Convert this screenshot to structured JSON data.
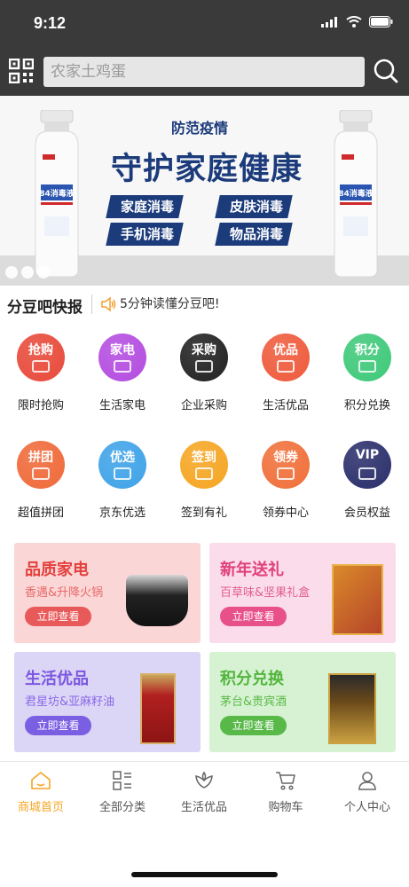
{
  "status": {
    "time": "9:12"
  },
  "search": {
    "placeholder": "农家土鸡蛋"
  },
  "banner": {
    "subtitle": "防范疫情",
    "title": "守护家庭健康",
    "tags": [
      "家庭消毒",
      "皮肤消毒",
      "手机消毒",
      "物品消毒"
    ],
    "bottle_label": "84消毒液"
  },
  "news": {
    "logo": "分豆吧快报",
    "text": "5分钟读懂分豆吧!"
  },
  "grid": [
    {
      "icon_text": "抢购",
      "label": "限时抢购",
      "color": "#e84a3a",
      "icon": "alarm-clock-icon"
    },
    {
      "icon_text": "家电",
      "label": "生活家电",
      "color": "#b44de0",
      "icon": "washing-machine-icon"
    },
    {
      "icon_text": "采购",
      "label": "企业采购",
      "color": "#222222",
      "icon": "purchase-icon"
    },
    {
      "icon_text": "优品",
      "label": "生活优品",
      "color": "#ef5b3c",
      "icon": "hand-icon"
    },
    {
      "icon_text": "积分",
      "label": "积分兑换",
      "color": "#3fc97a",
      "icon": "shop-icon"
    },
    {
      "icon_text": "拼团",
      "label": "超值拼团",
      "color": "#ef6a3a",
      "icon": "bag-icon"
    },
    {
      "icon_text": "优选",
      "label": "京东优选",
      "color": "#3fa3e8",
      "icon": "diamond-icon"
    },
    {
      "icon_text": "签到",
      "label": "签到有礼",
      "color": "#f5a623",
      "icon": "calendar-icon"
    },
    {
      "icon_text": "领券",
      "label": "领券中心",
      "color": "#f0703a",
      "icon": "coupon-icon"
    },
    {
      "icon_text": "VIP",
      "label": "会员权益",
      "color": "#2b2f6b",
      "icon": "crown-icon"
    }
  ],
  "promos": [
    {
      "title": "品质家电",
      "sub": "香遇&升降火锅",
      "button": "立即查看",
      "bg": "#fbd6d6",
      "title_color": "#e2403d",
      "sub_color": "#e86a6a",
      "btn_color": "#e85a5a"
    },
    {
      "title": "新年送礼",
      "sub": "百草味&坚果礼盒",
      "button": "立即查看",
      "bg": "#fbdcea",
      "title_color": "#e0407a",
      "sub_color": "#e06090",
      "btn_color": "#e8508a"
    },
    {
      "title": "生活优品",
      "sub": "君星坊&亚麻籽油",
      "button": "立即查看",
      "bg": "#dcd6f6",
      "title_color": "#7a57e0",
      "sub_color": "#8a6ae6",
      "btn_color": "#7b5fe3"
    },
    {
      "title": "积分兑换",
      "sub": "茅台&贵宾酒",
      "button": "立即查看",
      "bg": "#d6f2d3",
      "title_color": "#52b53c",
      "sub_color": "#5cba48",
      "btn_color": "#58b949"
    }
  ],
  "tabs": [
    {
      "label": "商城首页",
      "icon": "home-icon",
      "active": true
    },
    {
      "label": "全部分类",
      "icon": "category-icon",
      "active": false
    },
    {
      "label": "生活优品",
      "icon": "lotus-icon",
      "active": false
    },
    {
      "label": "购物车",
      "icon": "cart-icon",
      "active": false
    },
    {
      "label": "个人中心",
      "icon": "user-icon",
      "active": false
    }
  ],
  "colors": {
    "accent": "#f5a623",
    "bar_dark": "#3a3a3a",
    "banner_blue": "#1c3b7b"
  }
}
